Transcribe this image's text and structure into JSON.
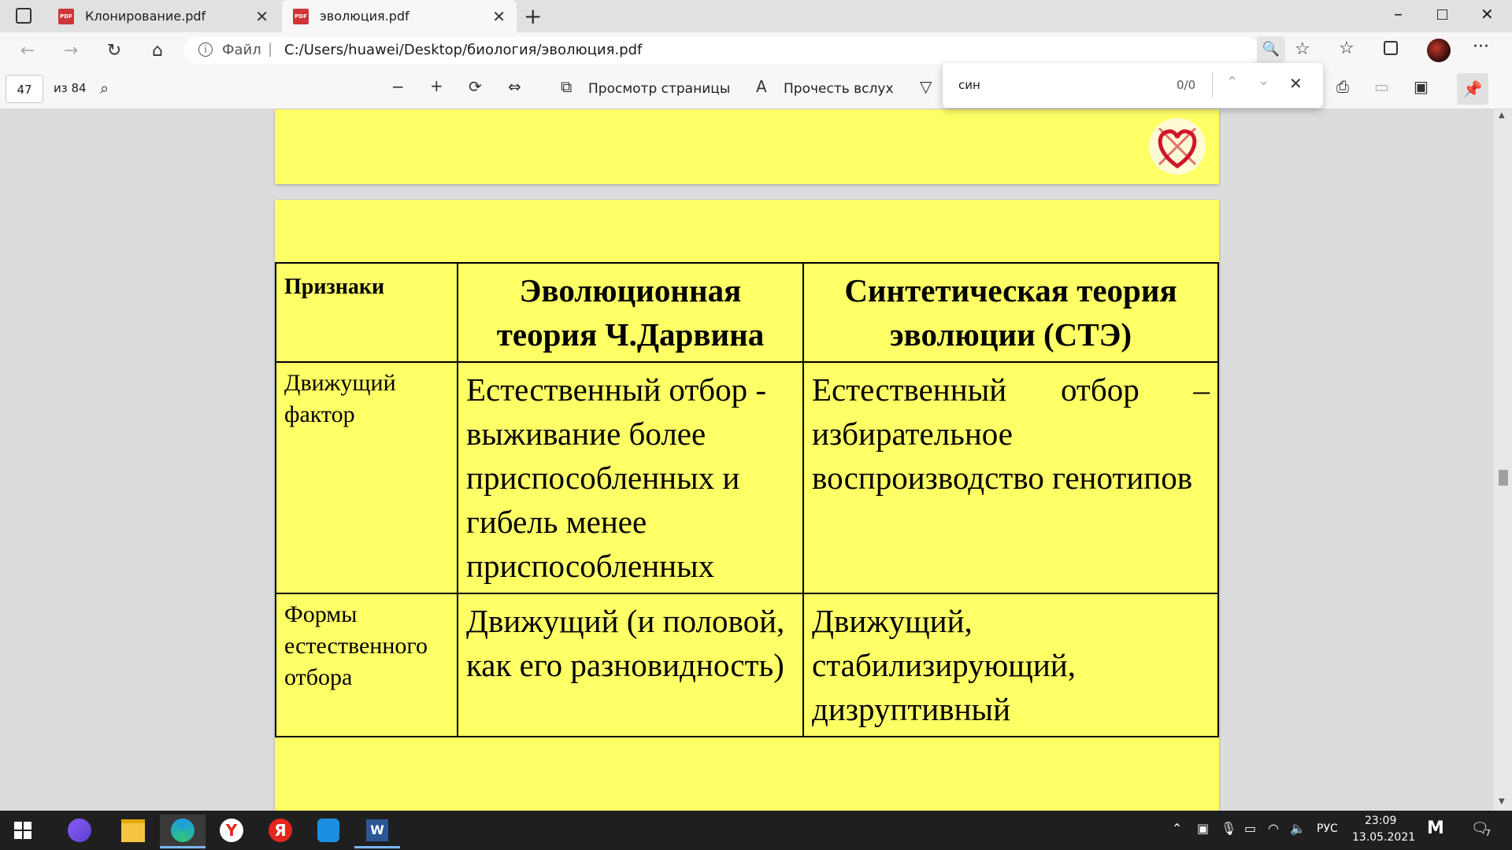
{
  "tabs": [
    {
      "title": "Клонирование.pdf",
      "active": false
    },
    {
      "title": "эволюция.pdf",
      "active": true
    }
  ],
  "address": {
    "scheme_label": "Файл",
    "separator": "|",
    "path": "C:/Users/huawei/Desktop/биология/эволюция.pdf"
  },
  "pdf_toolbar": {
    "page_current": "47",
    "page_total": "из 84",
    "page_view_label": "Просмотр страницы",
    "read_aloud_label": "Прочесть вслух"
  },
  "find": {
    "query": "син",
    "count": "0/0"
  },
  "table": {
    "headers": [
      "Признаки",
      "Эволюционная теория Ч.Дарвина",
      "Синтетическая теория эволюции (СТЭ)"
    ],
    "rows": [
      [
        "Движущий фактор",
        "Естественный отбор - выживание более приспособленных и гибель менее приспособленных",
        "Естественный отбор – избирательное воспроизводство генотипов"
      ],
      [
        "Формы естественного отбора",
        "Движущий (и половой, как его разновидность)",
        "Движущий, стабилизирующий, дизруптивный"
      ]
    ]
  },
  "tray": {
    "language": "РУС",
    "time": "23:09",
    "date": "13.05.2021",
    "notifications": "7"
  },
  "colors": {
    "slide_background": "#ffff66",
    "viewer_background": "#dcdcdc",
    "taskbar": "#1f1f1f"
  }
}
